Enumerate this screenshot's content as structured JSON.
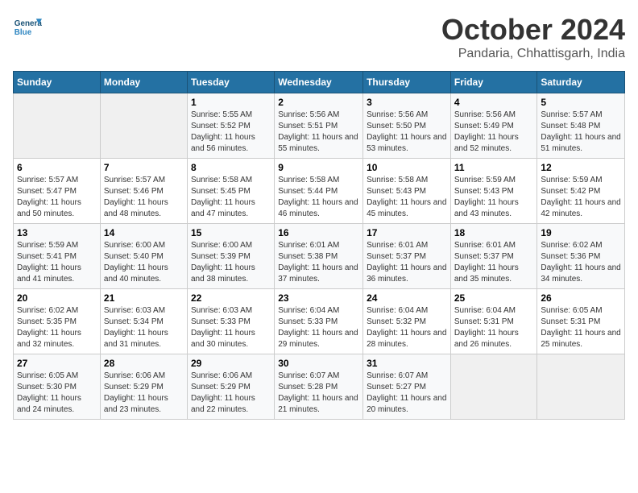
{
  "header": {
    "logo_general": "General",
    "logo_blue": "Blue",
    "month_title": "October 2024",
    "location": "Pandaria, Chhattisgarh, India"
  },
  "days_of_week": [
    "Sunday",
    "Monday",
    "Tuesday",
    "Wednesday",
    "Thursday",
    "Friday",
    "Saturday"
  ],
  "weeks": [
    [
      {
        "day": "",
        "empty": true
      },
      {
        "day": "",
        "empty": true
      },
      {
        "day": "1",
        "sunrise": "Sunrise: 5:55 AM",
        "sunset": "Sunset: 5:52 PM",
        "daylight": "Daylight: 11 hours and 56 minutes."
      },
      {
        "day": "2",
        "sunrise": "Sunrise: 5:56 AM",
        "sunset": "Sunset: 5:51 PM",
        "daylight": "Daylight: 11 hours and 55 minutes."
      },
      {
        "day": "3",
        "sunrise": "Sunrise: 5:56 AM",
        "sunset": "Sunset: 5:50 PM",
        "daylight": "Daylight: 11 hours and 53 minutes."
      },
      {
        "day": "4",
        "sunrise": "Sunrise: 5:56 AM",
        "sunset": "Sunset: 5:49 PM",
        "daylight": "Daylight: 11 hours and 52 minutes."
      },
      {
        "day": "5",
        "sunrise": "Sunrise: 5:57 AM",
        "sunset": "Sunset: 5:48 PM",
        "daylight": "Daylight: 11 hours and 51 minutes."
      }
    ],
    [
      {
        "day": "6",
        "sunrise": "Sunrise: 5:57 AM",
        "sunset": "Sunset: 5:47 PM",
        "daylight": "Daylight: 11 hours and 50 minutes."
      },
      {
        "day": "7",
        "sunrise": "Sunrise: 5:57 AM",
        "sunset": "Sunset: 5:46 PM",
        "daylight": "Daylight: 11 hours and 48 minutes."
      },
      {
        "day": "8",
        "sunrise": "Sunrise: 5:58 AM",
        "sunset": "Sunset: 5:45 PM",
        "daylight": "Daylight: 11 hours and 47 minutes."
      },
      {
        "day": "9",
        "sunrise": "Sunrise: 5:58 AM",
        "sunset": "Sunset: 5:44 PM",
        "daylight": "Daylight: 11 hours and 46 minutes."
      },
      {
        "day": "10",
        "sunrise": "Sunrise: 5:58 AM",
        "sunset": "Sunset: 5:43 PM",
        "daylight": "Daylight: 11 hours and 45 minutes."
      },
      {
        "day": "11",
        "sunrise": "Sunrise: 5:59 AM",
        "sunset": "Sunset: 5:43 PM",
        "daylight": "Daylight: 11 hours and 43 minutes."
      },
      {
        "day": "12",
        "sunrise": "Sunrise: 5:59 AM",
        "sunset": "Sunset: 5:42 PM",
        "daylight": "Daylight: 11 hours and 42 minutes."
      }
    ],
    [
      {
        "day": "13",
        "sunrise": "Sunrise: 5:59 AM",
        "sunset": "Sunset: 5:41 PM",
        "daylight": "Daylight: 11 hours and 41 minutes."
      },
      {
        "day": "14",
        "sunrise": "Sunrise: 6:00 AM",
        "sunset": "Sunset: 5:40 PM",
        "daylight": "Daylight: 11 hours and 40 minutes."
      },
      {
        "day": "15",
        "sunrise": "Sunrise: 6:00 AM",
        "sunset": "Sunset: 5:39 PM",
        "daylight": "Daylight: 11 hours and 38 minutes."
      },
      {
        "day": "16",
        "sunrise": "Sunrise: 6:01 AM",
        "sunset": "Sunset: 5:38 PM",
        "daylight": "Daylight: 11 hours and 37 minutes."
      },
      {
        "day": "17",
        "sunrise": "Sunrise: 6:01 AM",
        "sunset": "Sunset: 5:37 PM",
        "daylight": "Daylight: 11 hours and 36 minutes."
      },
      {
        "day": "18",
        "sunrise": "Sunrise: 6:01 AM",
        "sunset": "Sunset: 5:37 PM",
        "daylight": "Daylight: 11 hours and 35 minutes."
      },
      {
        "day": "19",
        "sunrise": "Sunrise: 6:02 AM",
        "sunset": "Sunset: 5:36 PM",
        "daylight": "Daylight: 11 hours and 34 minutes."
      }
    ],
    [
      {
        "day": "20",
        "sunrise": "Sunrise: 6:02 AM",
        "sunset": "Sunset: 5:35 PM",
        "daylight": "Daylight: 11 hours and 32 minutes."
      },
      {
        "day": "21",
        "sunrise": "Sunrise: 6:03 AM",
        "sunset": "Sunset: 5:34 PM",
        "daylight": "Daylight: 11 hours and 31 minutes."
      },
      {
        "day": "22",
        "sunrise": "Sunrise: 6:03 AM",
        "sunset": "Sunset: 5:33 PM",
        "daylight": "Daylight: 11 hours and 30 minutes."
      },
      {
        "day": "23",
        "sunrise": "Sunrise: 6:04 AM",
        "sunset": "Sunset: 5:33 PM",
        "daylight": "Daylight: 11 hours and 29 minutes."
      },
      {
        "day": "24",
        "sunrise": "Sunrise: 6:04 AM",
        "sunset": "Sunset: 5:32 PM",
        "daylight": "Daylight: 11 hours and 28 minutes."
      },
      {
        "day": "25",
        "sunrise": "Sunrise: 6:04 AM",
        "sunset": "Sunset: 5:31 PM",
        "daylight": "Daylight: 11 hours and 26 minutes."
      },
      {
        "day": "26",
        "sunrise": "Sunrise: 6:05 AM",
        "sunset": "Sunset: 5:31 PM",
        "daylight": "Daylight: 11 hours and 25 minutes."
      }
    ],
    [
      {
        "day": "27",
        "sunrise": "Sunrise: 6:05 AM",
        "sunset": "Sunset: 5:30 PM",
        "daylight": "Daylight: 11 hours and 24 minutes."
      },
      {
        "day": "28",
        "sunrise": "Sunrise: 6:06 AM",
        "sunset": "Sunset: 5:29 PM",
        "daylight": "Daylight: 11 hours and 23 minutes."
      },
      {
        "day": "29",
        "sunrise": "Sunrise: 6:06 AM",
        "sunset": "Sunset: 5:29 PM",
        "daylight": "Daylight: 11 hours and 22 minutes."
      },
      {
        "day": "30",
        "sunrise": "Sunrise: 6:07 AM",
        "sunset": "Sunset: 5:28 PM",
        "daylight": "Daylight: 11 hours and 21 minutes."
      },
      {
        "day": "31",
        "sunrise": "Sunrise: 6:07 AM",
        "sunset": "Sunset: 5:27 PM",
        "daylight": "Daylight: 11 hours and 20 minutes."
      },
      {
        "day": "",
        "empty": true
      },
      {
        "day": "",
        "empty": true
      }
    ]
  ]
}
